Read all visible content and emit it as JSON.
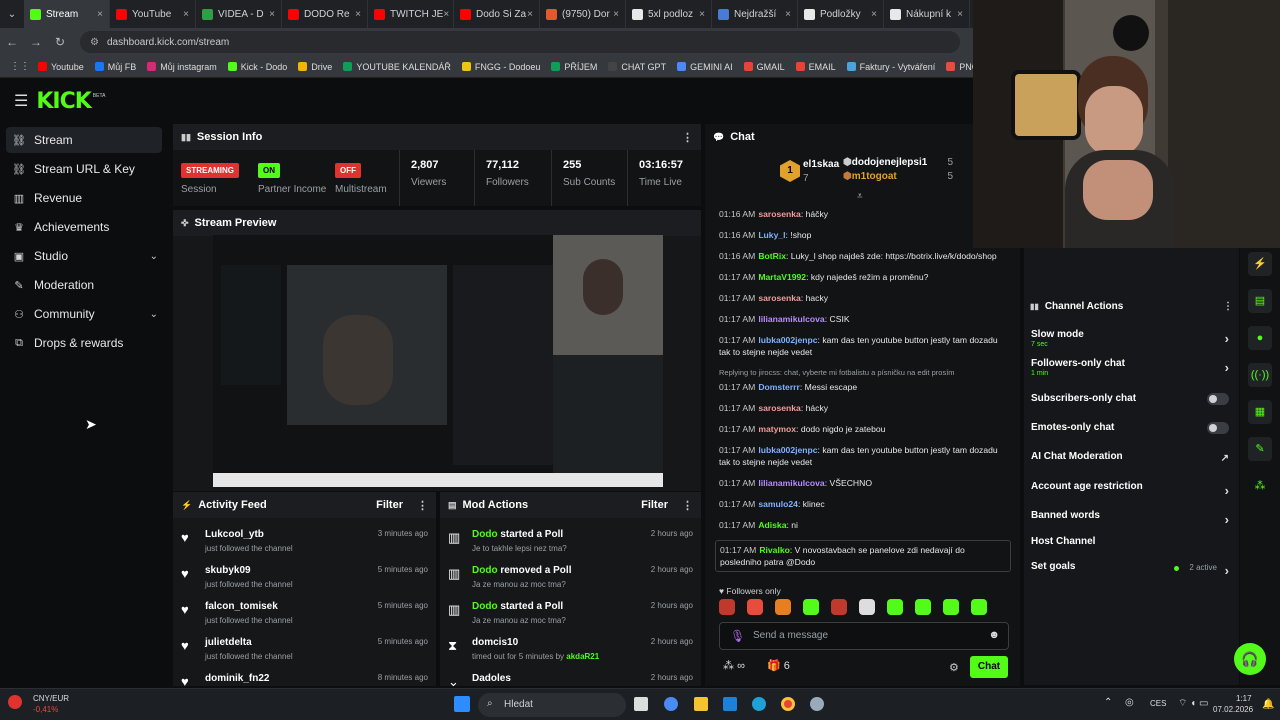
{
  "browser": {
    "tabs": [
      {
        "label": "Stream",
        "color": "#53fc18"
      },
      {
        "label": "YouTube",
        "color": "#ff0000"
      },
      {
        "label": "VIDEA - D",
        "color": "#2ea043"
      },
      {
        "label": "DODO Re",
        "color": "#ff0000"
      },
      {
        "label": "TWITCH JE",
        "color": "#ff0000"
      },
      {
        "label": "Dodo Si Za",
        "color": "#ff0000"
      },
      {
        "label": "(9750) Dor",
        "color": "#e05a2b"
      },
      {
        "label": "5xl podloz",
        "color": "#e8e8e8"
      },
      {
        "label": "Nejdražší",
        "color": "#4a7ad8"
      },
      {
        "label": "Podložky",
        "color": "#e8e8e8"
      },
      {
        "label": "Nákupní k",
        "color": "#e8e8e8"
      }
    ],
    "url": "dashboard.kick.com/stream",
    "bookmarks": [
      {
        "label": "Youtube",
        "color": "#ff0000"
      },
      {
        "label": "Můj FB",
        "color": "#1877f2"
      },
      {
        "label": "Můj instagram",
        "color": "#d62976"
      },
      {
        "label": "Kick - Dodo",
        "color": "#53fc18"
      },
      {
        "label": "Drive",
        "color": "#f4b400"
      },
      {
        "label": "YOUTUBE KALENDÁŘ",
        "color": "#0f9d58"
      },
      {
        "label": "FNGG - Dodoeu",
        "color": "#f1c40f"
      },
      {
        "label": "PŘÍJEM",
        "color": "#0f9d58"
      },
      {
        "label": "CHAT GPT",
        "color": "#444"
      },
      {
        "label": "GEMINI AI",
        "color": "#4a8af4"
      },
      {
        "label": "GMAIL",
        "color": "#ea4335"
      },
      {
        "label": "EMAIL",
        "color": "#ea4335"
      },
      {
        "label": "Faktury - Vytváření",
        "color": "#4aa3df"
      },
      {
        "label": "PNG to PDF",
        "color": "#e74c3c"
      }
    ]
  },
  "logo": "KICK",
  "logo_beta": "BETA",
  "sidebar": {
    "items": [
      {
        "label": "Stream",
        "icon": "link-icon",
        "active": true
      },
      {
        "label": "Stream URL & Key",
        "icon": "link-icon"
      },
      {
        "label": "Revenue",
        "icon": "bank-icon"
      },
      {
        "label": "Achievements",
        "icon": "trophy-icon"
      },
      {
        "label": "Studio",
        "icon": "studio-icon",
        "chevron": true
      },
      {
        "label": "Moderation",
        "icon": "wrench-icon"
      },
      {
        "label": "Community",
        "icon": "people-icon",
        "chevron": true
      },
      {
        "label": "Drops & rewards",
        "icon": "drops-icon"
      }
    ]
  },
  "session": {
    "title": "Session Info",
    "stats": [
      {
        "value": "STREAMING",
        "label": "Session",
        "pill": "#e0322f"
      },
      {
        "value": "ON",
        "label": "Partner Income",
        "pill": "#53fc18"
      },
      {
        "value": "OFF",
        "label": "Multistream",
        "pill": "#e0322f"
      },
      {
        "value": "2,807",
        "label": "Viewers"
      },
      {
        "value": "77,112",
        "label": "Followers"
      },
      {
        "value": "255",
        "label": "Sub Counts"
      },
      {
        "value": "03:16:57",
        "label": "Time Live"
      }
    ]
  },
  "preview": {
    "title": "Stream Preview"
  },
  "activity": {
    "title": "Activity Feed",
    "filter": "Filter",
    "rows": [
      {
        "name": "Lukcool_ytb",
        "sub": "just followed the channel",
        "time": "3 minutes ago"
      },
      {
        "name": "skubyk09",
        "sub": "just followed the channel",
        "time": "5 minutes ago"
      },
      {
        "name": "falcon_tomisek",
        "sub": "just followed the channel",
        "time": "5 minutes ago"
      },
      {
        "name": "julietdelta",
        "sub": "just followed the channel",
        "time": "5 minutes ago"
      },
      {
        "name": "dominik_fn22",
        "sub": "",
        "time": "8 minutes ago"
      }
    ]
  },
  "mod": {
    "title": "Mod Actions",
    "filter": "Filter",
    "rows": [
      {
        "name": "Dodo",
        "action": "started a Poll",
        "sub": "Je to takhle lepsi nez tma?",
        "time": "2 hours ago"
      },
      {
        "name": "Dodo",
        "action": "removed a Poll",
        "sub": "Ja ze manou az moc tma?",
        "time": "2 hours ago"
      },
      {
        "name": "Dodo",
        "action": "started a Poll",
        "sub": "Ja ze manou az moc tma?",
        "time": "2 hours ago"
      },
      {
        "name": "domcis10",
        "action": "",
        "sub": "timed out for 5 minutes by",
        "by": "akdaR21",
        "time": "2 hours ago"
      },
      {
        "name": "Dadoles",
        "action": "",
        "sub": "",
        "time": "2 hours ago"
      }
    ]
  },
  "chat": {
    "title": "Chat",
    "top_rank": "1",
    "top_user": "el1skaa",
    "top_count": "7",
    "leaders": [
      {
        "name": "dodojenejlepsi1",
        "count": "5"
      },
      {
        "name": "m1togoat",
        "count": "5"
      }
    ],
    "messages": [
      {
        "time": "01:16 AM",
        "user": "sarosenka",
        "color": "#f39c9c",
        "text": "háčky"
      },
      {
        "time": "01:16 AM",
        "user": "Luky_l",
        "color": "#7fb2ff",
        "text": "!shop"
      },
      {
        "time": "01:16 AM",
        "user": "BotRix",
        "color": "#53fc18",
        "text": "Luky_l shop najdeš zde: https://botrix.live/k/dodo/shop"
      },
      {
        "time": "01:17 AM",
        "user": "MartaV1992",
        "color": "#53fc18",
        "text": "kdy najedeš režim a proměnu?"
      },
      {
        "time": "01:17 AM",
        "user": "sarosenka",
        "color": "#f39c9c",
        "text": "hacky"
      },
      {
        "time": "01:17 AM",
        "user": "lilianamikulcova",
        "color": "#b88cff",
        "text": "CSIK"
      },
      {
        "time": "01:17 AM",
        "user": "lubka002jenpc",
        "color": "#7fb2ff",
        "text": "kam das ten youtube button jestly tam dozadu tak to stejne nejde vedet"
      },
      {
        "time": "01:17 AM",
        "user": "Domsterrr",
        "color": "#7fb2ff",
        "text": "Messi escape",
        "reply": "Replying to jirocss: chat, vyberte mi fotbalistu a písničku na edit prosím"
      },
      {
        "time": "01:17 AM",
        "user": "sarosenka",
        "color": "#f39c9c",
        "text": "hácky"
      },
      {
        "time": "01:17 AM",
        "user": "matymox",
        "color": "#f39c9c",
        "text": "dodo nigdo je zatebou"
      },
      {
        "time": "01:17 AM",
        "user": "lubka002jenpc",
        "color": "#7fb2ff",
        "text": "kam das ten youtube button jestly tam dozadu tak to stejne nejde vedet"
      },
      {
        "time": "01:17 AM",
        "user": "lilianamikulcova",
        "color": "#b88cff",
        "text": "VŠECHNO"
      },
      {
        "time": "01:17 AM",
        "user": "samulo24",
        "color": "#7fb2ff",
        "text": "klinec"
      },
      {
        "time": "01:17 AM",
        "user": "Adiska",
        "color": "#53fc18",
        "text": "ni"
      },
      {
        "time": "01:17 AM",
        "user": "Rivalko",
        "color": "#53fc18",
        "text": "V novostavbach se panelove zdi nedavají do posledniho patra @Dodo",
        "highlight": true
      }
    ],
    "followers_only": "Followers only",
    "placeholder": "Send a message",
    "stat_link": "∞",
    "stat_count": "6",
    "send": "Chat"
  },
  "actions": {
    "title": "Channel Actions",
    "rows": [
      {
        "label": "Slow mode",
        "sub": "7 sec",
        "kind": "arrow"
      },
      {
        "label": "Followers-only chat",
        "sub": "1 min",
        "kind": "arrow"
      },
      {
        "label": "Subscribers-only chat",
        "kind": "toggle"
      },
      {
        "label": "Emotes-only chat",
        "kind": "toggle"
      },
      {
        "label": "AI Chat Moderation",
        "kind": "external"
      },
      {
        "label": "Account age restriction",
        "kind": "arrow"
      },
      {
        "label": "Banned words",
        "kind": "arrow"
      },
      {
        "label": "Host Channel",
        "kind": "none"
      },
      {
        "label": "Set goals",
        "kind": "arrow",
        "status": "2 active"
      }
    ]
  },
  "taskbar": {
    "ticker": "CNY/EUR",
    "ticker_change": "-0,41%",
    "search": "Hledat",
    "lang": "CES",
    "time": "1:17",
    "date": "07.02.2026"
  }
}
